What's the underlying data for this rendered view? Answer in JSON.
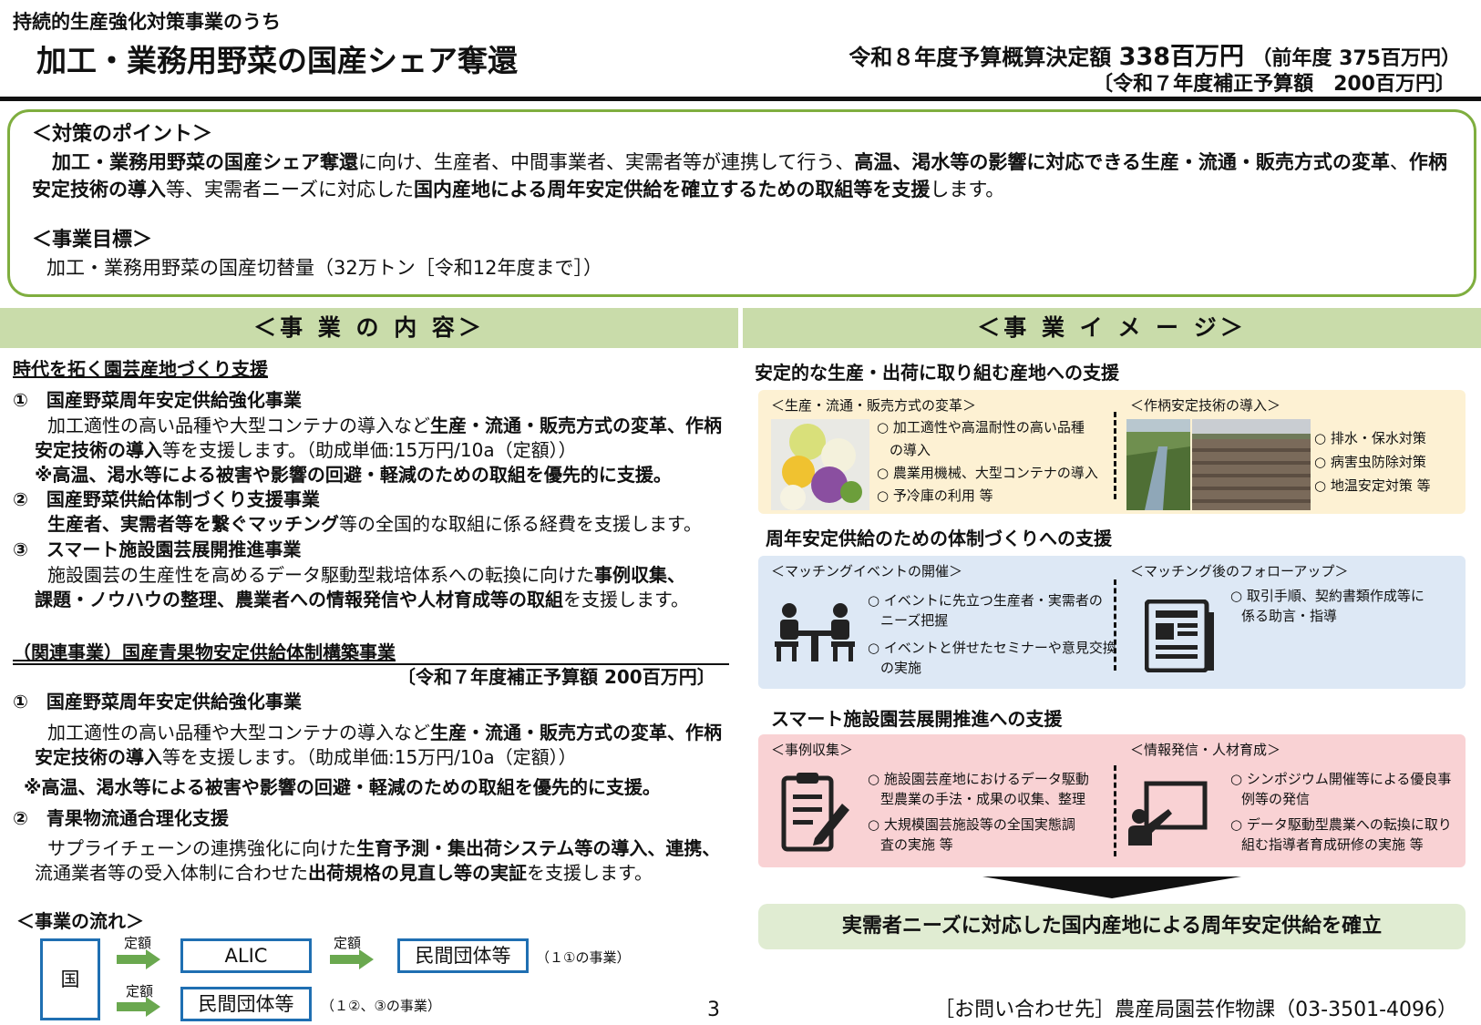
{
  "header": {
    "subtitle": "持続的生産強化対策事業のうち",
    "title": "加工・業務用野菜の国産シェア奪還",
    "budget_label": "令和８年度予算概算決定額",
    "budget_value": "338百万円",
    "budget_prev": "（前年度 375百万円）",
    "supplementary": "〔令和７年度補正予算額　200百万円〕"
  },
  "points": {
    "heading": "＜対策のポイント＞",
    "t1": "加工・業務用野菜の国産シェア奪還",
    "t2": "に向け、生産者、中間事業者、実需者等が連携して行う、",
    "t3": "高温、渇水等の影響に対応できる生産・流通・販売方式の変革",
    "t4": "、",
    "t5": "作柄安定技術の導入",
    "t6": "等、実需者ニーズに対応した",
    "t7": "国内産地による周年安定供給を確立するための取組等を支援",
    "t8": "します。",
    "goal_heading": "＜事業目標＞",
    "goal_text": "加工・業務用野菜の国産切替量（32万トン［令和12年度まで］）"
  },
  "left": {
    "section_title": "＜事 業 の 内 容＞",
    "main_heading": "時代を拓く園芸産地づくり支援",
    "i1_title": "①　国産野菜周年安定供給強化事業",
    "i1_a": "加工適性の高い品種や大型コンテナの導入など",
    "i1_b": "生産・流通・販売方式の変革、作柄",
    "i1_c": "安定技術の導入",
    "i1_d": "等を支援します。（助成単価:15万円/10a（定額））",
    "i1_note": "※高温、渇水等による被害や影響の回避・軽減のための取組を優先的に支援。",
    "i2_title": "②　国産野菜供給体制づくり支援事業",
    "i2_a": "生産者、実需者等を繋ぐマッチング",
    "i2_b": "等の全国的な取組に係る経費を支援します。",
    "i3_title": "③　スマート施設園芸展開推進事業",
    "i3_a": "施設園芸の生産性を高めるデータ駆動型栽培体系への転換に向けた",
    "i3_b": "事例収集、",
    "i3_c": "課題・ノウハウの整理、農業者への情報発信や人材育成等の取組",
    "i3_d": "を支援します。",
    "related_heading": "（関連事業）国産青果物安定供給体制構築事業",
    "related_budget": "〔令和７年度補正予算額 200百万円〕",
    "r1_title": "①　国産野菜周年安定供給強化事業",
    "r1_a": "加工適性の高い品種や大型コンテナの導入など",
    "r1_b": "生産・流通・販売方式の変革、作柄",
    "r1_c": "安定技術の導入",
    "r1_d": "等を支援します。（助成単価:15万円/10a（定額））",
    "r1_note": "※高温、渇水等による被害や影響の回避・軽減のための取組を優先的に支援。",
    "r2_title": "②　青果物流通合理化支援",
    "r2_a": "サプライチェーンの連携強化に向けた",
    "r2_b": "生育予測・集出荷システム等の導入、連携、",
    "r2_c": "流通業者等の受入体制に合わせた",
    "r2_d": "出荷規格の見直し等の実証",
    "r2_e": "を支援します。",
    "flow_heading": "＜事業の流れ＞",
    "flow_country": "国",
    "flow_teigaku": "定額",
    "flow_alic": "ALIC",
    "flow_private1": "民間団体等",
    "flow_private2": "民間団体等",
    "flow_note1": "（１①の事業）",
    "flow_note2": "（１②、③の事業）"
  },
  "right": {
    "section_title": "＜事 業 イ メ ー ジ＞",
    "s1_heading": "安定的な生産・出荷に取り組む産地への支援",
    "s1_sub1": "＜生産・流通・販売方式の変革＞",
    "s1_sub2": "＜作柄安定技術の導入＞",
    "s1_b1": "○ 加工適性や高温耐性の高い品種",
    "s1_b1b": "の導入",
    "s1_b2": "○ 農業用機械、大型コンテナの導入",
    "s1_b3": "○ 予冷庫の利用 等",
    "s1_c1": "○ 排水・保水対策",
    "s1_c2": "○ 病害虫防除対策",
    "s1_c3": "○ 地温安定対策 等",
    "s2_heading": "周年安定供給のための体制づくりへの支援",
    "s2_sub1": "＜マッチングイベントの開催＞",
    "s2_sub2": "＜マッチング後のフォローアップ＞",
    "s2_b1": "○ イベントに先立つ生産者・実需者の",
    "s2_b1b": "ニーズ把握",
    "s2_b2": "○ イベントと併せたセミナーや意見交換",
    "s2_b2b": "の実施",
    "s2_c1": "○ 取引手順、契約書類作成等に",
    "s2_c1b": "係る助言・指導",
    "s3_heading": "スマート施設園芸展開推進への支援",
    "s3_sub1": "＜事例収集＞",
    "s3_sub2": "＜情報発信・人材育成＞",
    "s3_b1": "○ 施設園芸産地におけるデータ駆動",
    "s3_b1b": "型農業の手法・成果の収集、整理",
    "s3_b2": "○ 大規模園芸施設等の全国実態調",
    "s3_b2b": "査の実施 等",
    "s3_c1": "○ シンポジウム開催等による優良事",
    "s3_c1b": "例等の発信",
    "s3_c2": "○ データ駆動型農業への転換に取り",
    "s3_c2b": "組む指導者育成研修の実施 等",
    "result": "実需者ニーズに対応した国内産地による周年安定供給を確立"
  },
  "footer": {
    "page": "3",
    "contact": "［お問い合わせ先］農産局園芸作物課（03-3501-4096）"
  },
  "icons": [
    "cauliflower-photo",
    "field-photo-1",
    "field-photo-2",
    "meeting-icon",
    "newspaper-icon",
    "clipboard-icon",
    "presentation-icon",
    "down-triangle-icon",
    "green-arrow-icon"
  ],
  "colors": {
    "green_border": "#7fae3f",
    "section_bar": "#c9dcaa",
    "panel_yellow": "#fdf1d3",
    "panel_blue": "#dde8f5",
    "panel_pink": "#f9d2d4",
    "result_bar": "#e0ecd2",
    "flow_blue": "#1f6fb2",
    "arrow_green": "#6aa84f"
  }
}
